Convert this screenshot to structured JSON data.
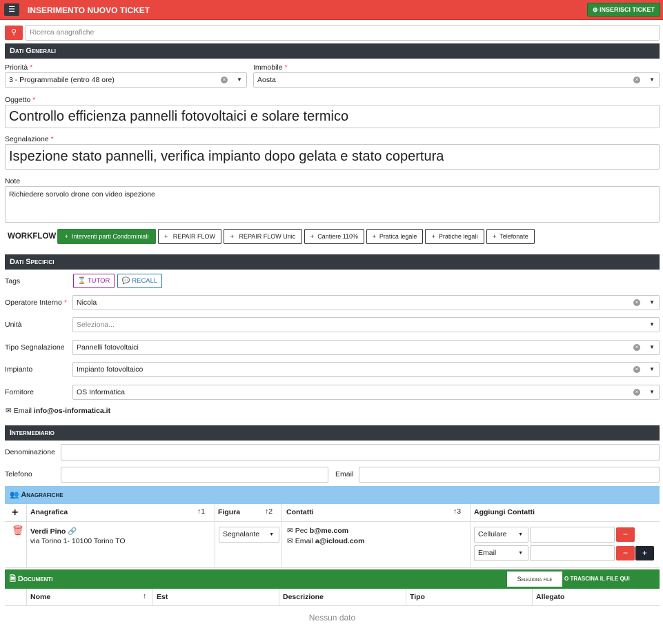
{
  "header": {
    "title": "INSERIMENTO NUOVO TICKET",
    "insert_label": "INSERISCI TICKET"
  },
  "search": {
    "placeholder": "Ricerca anagrafiche"
  },
  "dati_generali": {
    "title": "Dati Generali",
    "priorita_label": "Priorità",
    "priorita_value": "3 - Programmabile (entro 48 ore)",
    "immobile_label": "Immobile",
    "immobile_value": "Aosta",
    "oggetto_label": "Oggetto",
    "oggetto_value": "Controllo efficienza pannelli fotovoltaici e solare termico",
    "segnalazione_label": "Segnalazione",
    "segnalazione_value": "Ispezione stato pannelli, verifica impianto dopo gelata e stato copertura",
    "note_label": "Note",
    "note_value": "Richiedere sorvolo drone con video ispezione"
  },
  "workflow": {
    "label": "WORKFLOW",
    "buttons": [
      "Interventi parti Condominiali",
      "REPAIR FLOW",
      "REPAIR FLOW Unic",
      "Cantiere 110%",
      "Pratica legale",
      "Pratiche legali",
      "Telefonate"
    ]
  },
  "dati_specifici": {
    "title": "Dati Specifici",
    "tags_label": "Tags",
    "tags": [
      "TUTOR",
      "RECALL"
    ],
    "operatore_label": "Operatore Interno",
    "operatore_value": "Nicola",
    "unita_label": "Unità",
    "unita_placeholder": "Seleziona...",
    "tipo_label": "Tipo Segnalazione",
    "tipo_value": "Pannelli fotovoltaici",
    "impianto_label": "Impianto",
    "impianto_value": "Impianto fotovoltaico",
    "fornitore_label": "Fornitore",
    "fornitore_value": "OS Informatica",
    "email_label": "Email",
    "email_value": "info@os-informatica.it"
  },
  "intermediario": {
    "title": "Intermediario",
    "denominazione_label": "Denominazione",
    "telefono_label": "Telefono",
    "email_label": "Email"
  },
  "anagrafiche": {
    "title": "Anagrafiche",
    "columns": [
      "Anagrafica",
      "Figura",
      "Contatti",
      "Aggiungi Contatti"
    ],
    "sort_marks": [
      "↑1",
      "↑2",
      "↑3"
    ],
    "row": {
      "name": "Verdi Pino",
      "address": "via Torino 1- 10100 Torino TO",
      "figura": "Segnalante",
      "pec_label": "Pec",
      "pec_value": "b@me.com",
      "email_label": "Email",
      "email_value": "a@icloud.com",
      "contact_types": [
        "Cellulare",
        "Email"
      ]
    }
  },
  "documenti": {
    "title": "Documenti",
    "select_file": "Seleziona file",
    "drop_text": "O TRASCINA IL FILE QUI",
    "columns": [
      "Nome",
      "Est",
      "Descrizione",
      "Tipo",
      "Allegato"
    ],
    "empty": "Nessun dato"
  },
  "colors": {
    "primary_red": "#e8473f",
    "dark": "#343a40",
    "green": "#2e8b3a",
    "light_blue": "#90c8f0",
    "tutor": "#a020a0",
    "recall": "#2a7ab0"
  }
}
